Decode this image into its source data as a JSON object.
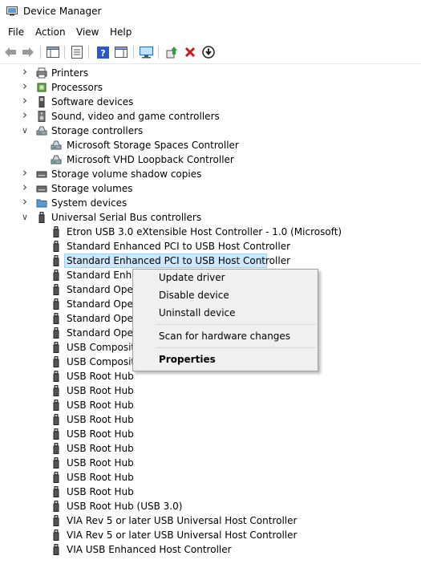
{
  "window": {
    "title": "Device Manager"
  },
  "menu": [
    "File",
    "Action",
    "View",
    "Help"
  ],
  "tree": [
    {
      "label": "Printers",
      "level": 0,
      "state": "collapsed",
      "icon": "printer-icon"
    },
    {
      "label": "Processors",
      "level": 0,
      "state": "collapsed",
      "icon": "processor-icon"
    },
    {
      "label": "Software devices",
      "level": 0,
      "state": "collapsed",
      "icon": "software-device-icon"
    },
    {
      "label": "Sound, video and game controllers",
      "level": 0,
      "state": "collapsed",
      "icon": "speaker-icon"
    },
    {
      "label": "Storage controllers",
      "level": 0,
      "state": "expanded",
      "icon": "storage-controller-icon"
    },
    {
      "label": "Microsoft Storage Spaces Controller",
      "level": 1,
      "state": "leaf",
      "icon": "storage-controller-icon"
    },
    {
      "label": "Microsoft VHD Loopback Controller",
      "level": 1,
      "state": "leaf",
      "icon": "storage-controller-icon"
    },
    {
      "label": "Storage volume shadow copies",
      "level": 0,
      "state": "collapsed",
      "icon": "drive-icon"
    },
    {
      "label": "Storage volumes",
      "level": 0,
      "state": "collapsed",
      "icon": "drive-icon"
    },
    {
      "label": "System devices",
      "level": 0,
      "state": "collapsed",
      "icon": "system-folder-icon"
    },
    {
      "label": "Universal Serial Bus controllers",
      "level": 0,
      "state": "expanded",
      "icon": "usb-icon"
    },
    {
      "label": "Etron USB 3.0 eXtensible Host Controller - 1.0 (Microsoft)",
      "level": 1,
      "state": "leaf",
      "icon": "usb-icon"
    },
    {
      "label": "Standard Enhanced PCI to USB Host Controller",
      "level": 1,
      "state": "leaf",
      "icon": "usb-icon"
    },
    {
      "label": "Standard Enhanced PCI to USB Host Controller",
      "level": 1,
      "state": "selected",
      "icon": "usb-icon"
    },
    {
      "label": "Standard Enhan",
      "level": 1,
      "state": "leaf",
      "icon": "usb-icon"
    },
    {
      "label": "Standard Open",
      "level": 1,
      "state": "leaf",
      "icon": "usb-icon"
    },
    {
      "label": "Standard Open",
      "level": 1,
      "state": "leaf",
      "icon": "usb-icon"
    },
    {
      "label": "Standard Open",
      "level": 1,
      "state": "leaf",
      "icon": "usb-icon"
    },
    {
      "label": "Standard Open",
      "level": 1,
      "state": "leaf",
      "icon": "usb-icon"
    },
    {
      "label": "USB Composite",
      "level": 1,
      "state": "leaf",
      "icon": "usb-icon"
    },
    {
      "label": "USB Composite",
      "level": 1,
      "state": "leaf",
      "icon": "usb-icon"
    },
    {
      "label": "USB Root Hub",
      "level": 1,
      "state": "leaf",
      "icon": "usb-icon"
    },
    {
      "label": "USB Root Hub",
      "level": 1,
      "state": "leaf",
      "icon": "usb-icon"
    },
    {
      "label": "USB Root Hub",
      "level": 1,
      "state": "leaf",
      "icon": "usb-icon"
    },
    {
      "label": "USB Root Hub",
      "level": 1,
      "state": "leaf",
      "icon": "usb-icon"
    },
    {
      "label": "USB Root Hub",
      "level": 1,
      "state": "leaf",
      "icon": "usb-icon"
    },
    {
      "label": "USB Root Hub",
      "level": 1,
      "state": "leaf",
      "icon": "usb-icon"
    },
    {
      "label": "USB Root Hub",
      "level": 1,
      "state": "leaf",
      "icon": "usb-icon"
    },
    {
      "label": "USB Root Hub",
      "level": 1,
      "state": "leaf",
      "icon": "usb-icon"
    },
    {
      "label": "USB Root Hub",
      "level": 1,
      "state": "leaf",
      "icon": "usb-icon"
    },
    {
      "label": "USB Root Hub (USB 3.0)",
      "level": 1,
      "state": "leaf",
      "icon": "usb-icon"
    },
    {
      "label": "VIA Rev 5 or later USB Universal Host Controller",
      "level": 1,
      "state": "leaf",
      "icon": "usb-icon"
    },
    {
      "label": "VIA Rev 5 or later USB Universal Host Controller",
      "level": 1,
      "state": "leaf",
      "icon": "usb-icon"
    },
    {
      "label": "VIA USB Enhanced Host Controller",
      "level": 1,
      "state": "leaf",
      "icon": "usb-icon"
    }
  ],
  "context_menu": {
    "items": [
      "Update driver",
      "Disable device",
      "Uninstall device"
    ],
    "scan": "Scan for hardware changes",
    "properties": "Properties"
  },
  "colors": {
    "selection": "#cce8ff",
    "selection_border": "#99d1ff",
    "delete_red": "#d0161b",
    "help_blue": "#2b58c9"
  }
}
